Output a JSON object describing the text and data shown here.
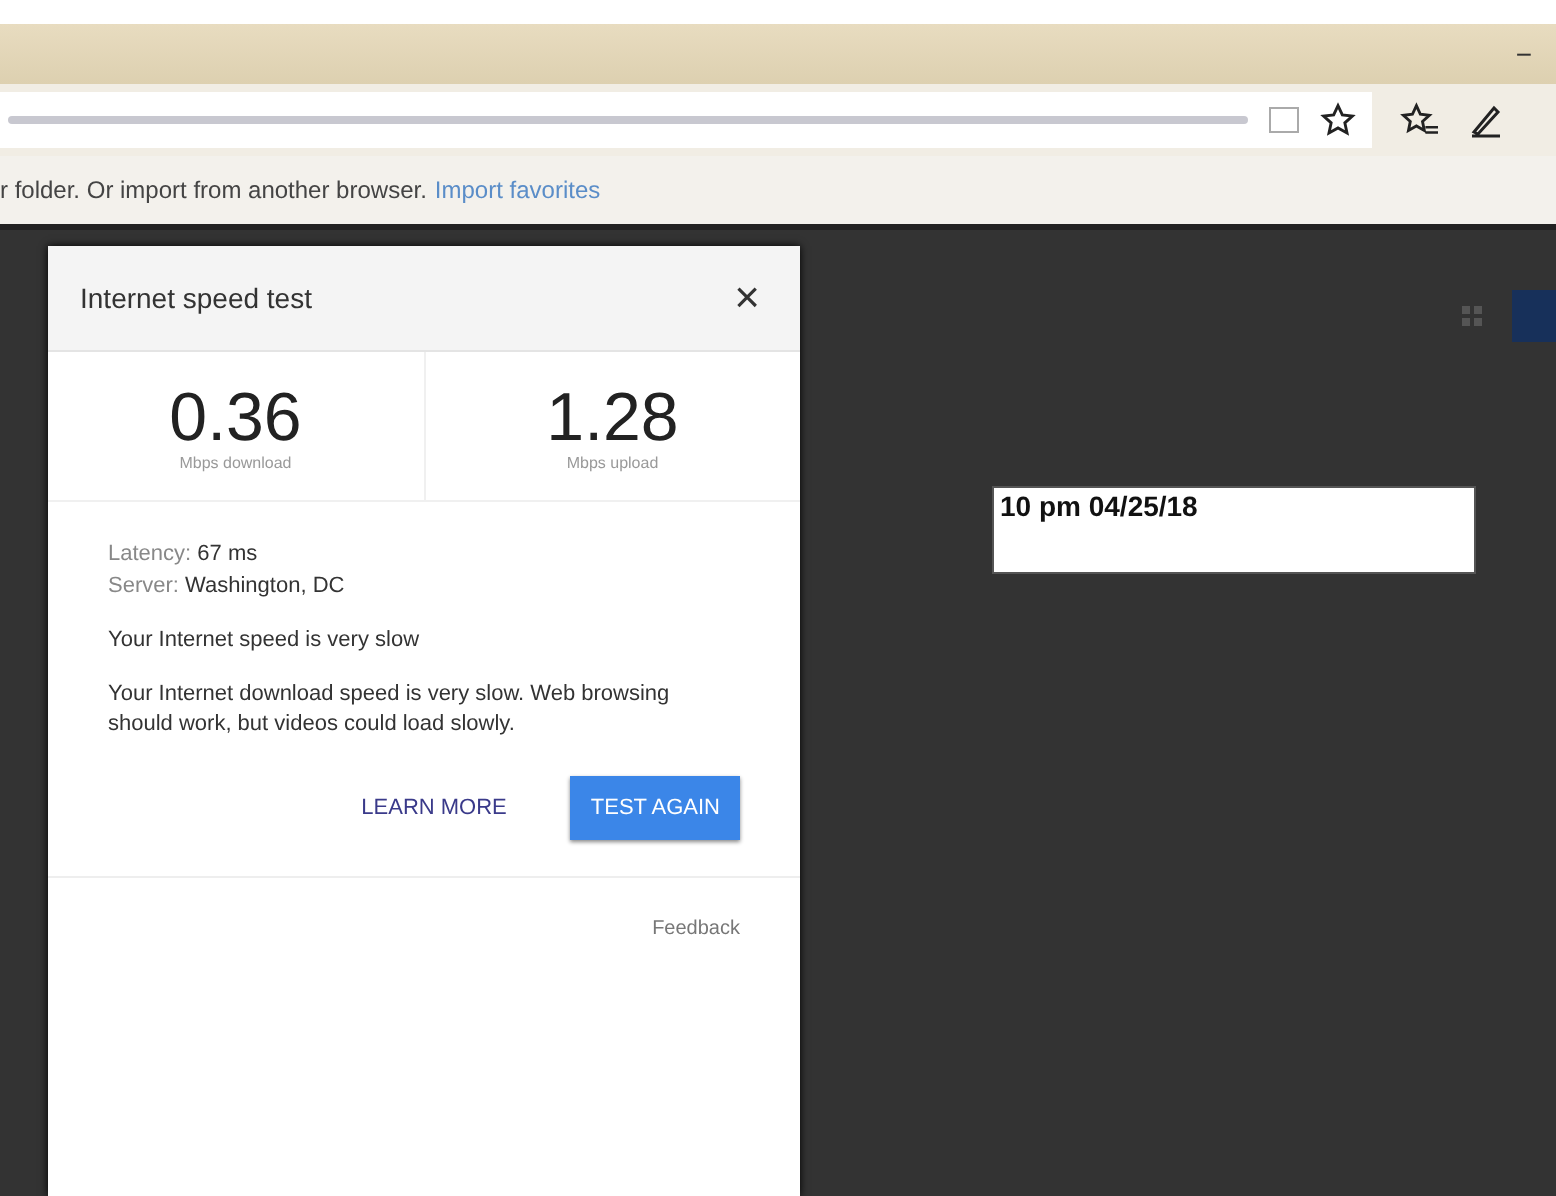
{
  "browser": {
    "minimize": "−",
    "favorites_bar": {
      "message": "r folder. Or import from another browser.",
      "link": "Import favorites"
    }
  },
  "dialog": {
    "title": "Internet speed test",
    "close": "×",
    "results": [
      {
        "value": "0.36",
        "unit": "Mbps download"
      },
      {
        "value": "1.28",
        "unit": "Mbps upload"
      }
    ],
    "details": [
      {
        "label": "Latency:",
        "value": "67 ms"
      },
      {
        "label": "Server:",
        "value": "Washington, DC"
      }
    ],
    "summary": "Your Internet speed is very slow",
    "description": "Your Internet download speed is very slow. Web browsing should work, but videos could load slowly.",
    "buttons": [
      {
        "label": "LEARN MORE",
        "kind": "text"
      },
      {
        "label": "TEST AGAIN",
        "kind": "filled"
      }
    ],
    "feedback": "Feedback"
  },
  "timestamp": "10 pm 04/25/18"
}
